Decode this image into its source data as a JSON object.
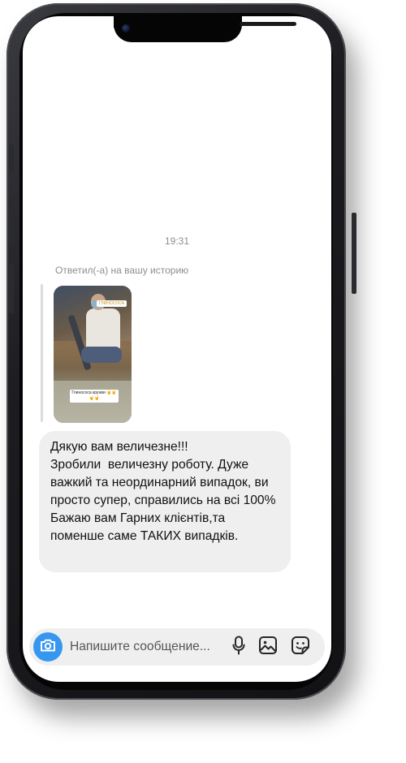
{
  "chat": {
    "timestamp": "19:31",
    "reply_label": "Ответил(-а) на вашу историю",
    "story": {
      "tag": "ГЛИНОСОСА",
      "caption": "Глинососа кружки 🤘🤘🤘🤘"
    },
    "message": "Дякую вам величезне!!!\nЗробили  величезну роботу. Дуже важкий та неординарний випадок, ви просто супер, справились на всі 100%\nБажаю вам Гарних клієнтів,та поменше саме ТАКИХ випадків."
  },
  "composer": {
    "placeholder": "Напишите сообщение...",
    "icons": {
      "camera": "camera-icon",
      "mic": "microphone-icon",
      "gallery": "gallery-icon",
      "sticker": "sticker-icon"
    },
    "accent": "#3797f0"
  }
}
